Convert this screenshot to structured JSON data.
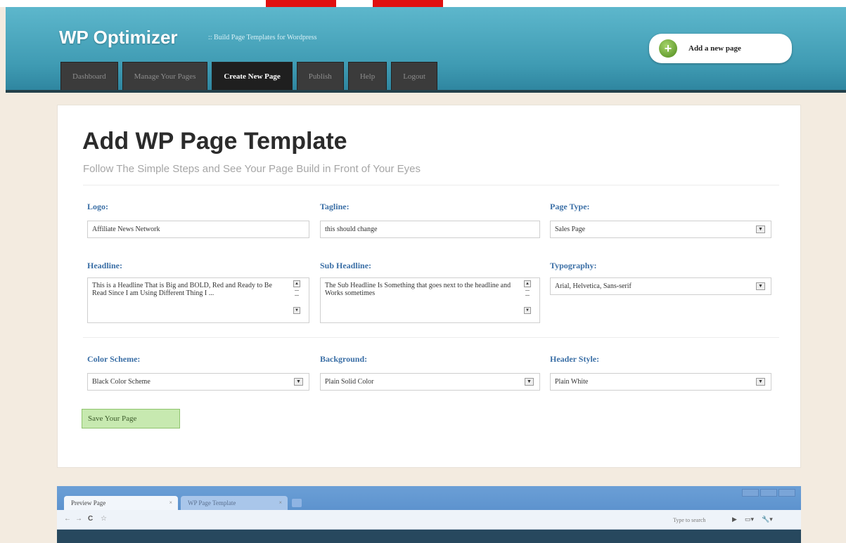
{
  "header": {
    "title": "WP Optimizer",
    "subtitle": ":: Build Page Templates for Wordpress",
    "add_page_label": "Add a new page",
    "nav_tabs": [
      {
        "label": "Dashboard"
      },
      {
        "label": "Manage Your Pages"
      },
      {
        "label": "Create New Page"
      },
      {
        "label": "Publish"
      },
      {
        "label": "Help"
      },
      {
        "label": "Logout"
      }
    ],
    "active_tab": "Create New Page"
  },
  "form": {
    "title": "Add WP Page Template",
    "subtitle": "Follow The Simple Steps and See Your Page Build in Front of Your Eyes",
    "logo": {
      "label": "Logo:",
      "value": "Affiliate News Network"
    },
    "tagline": {
      "label": "Tagline:",
      "value": "this should change"
    },
    "page_type": {
      "label": "Page Type:",
      "value": "Sales Page"
    },
    "headline": {
      "label": "Headline:",
      "value": "This is a Headline That is Big and BOLD, Red and Ready to Be Read Since I am Using Different Thing I ..."
    },
    "sub_headline": {
      "label": "Sub Headline:",
      "value": "The Sub Headline Is Something that goes next to the headline and Works sometimes"
    },
    "typography": {
      "label": "Typography:",
      "value": "Arial, Helvetica, Sans-serif"
    },
    "color_scheme": {
      "label": "Color Scheme:",
      "value": "Black Color Scheme"
    },
    "background": {
      "label": "Background:",
      "value": "Plain Solid Color"
    },
    "header_style": {
      "label": "Header Style:",
      "value": "Plain White"
    },
    "save_label": "Save Your Page"
  },
  "browser": {
    "tab_active": "Preview Page",
    "tab_inactive": "WP Page Template",
    "search_hint": "Type to search"
  },
  "colors": {
    "header_teal": "#3f9bb3",
    "nav_dark": "#1f1f1f",
    "label_blue": "#3b6fa6",
    "save_green": "#c7e9b0",
    "page_bg": "#f3ebe0",
    "accent_red": "#e01010"
  },
  "icons": {
    "add_page": "plus-icon",
    "dropdown": "chevron-down-icon"
  }
}
